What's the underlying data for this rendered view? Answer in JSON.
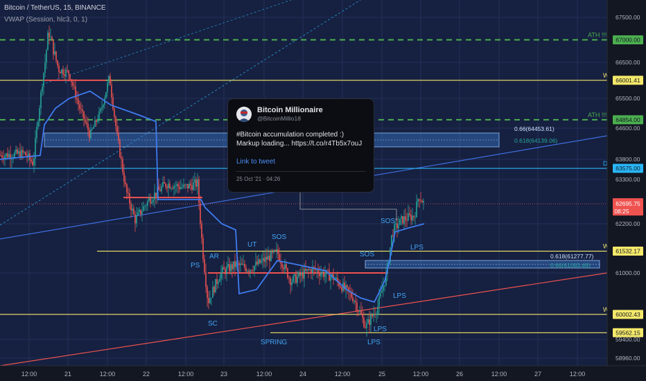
{
  "header": {
    "title": "Bitcoin / TetherUS, 15, BINANCE",
    "indicator": "VWAP (Session, hlc3, 0, 1)"
  },
  "colors": {
    "background": "#131722",
    "grid": "#1f2a4a",
    "vwap": "#2962ff",
    "green": "#26a69a",
    "red": "#ef5350",
    "yellow": "#f5e96a",
    "ath": "#4caf50",
    "cyan": "#29b6f6",
    "label_blue": "#42a5f5"
  },
  "tweet": {
    "name": "Bitcoin Millionaire",
    "handle": "@BitcoinMillio18",
    "text": "#Bitcoin accumulation completed :) Markup loading... https://t.co/r4Tb5x7ouJ",
    "link": "Link to tweet",
    "time": "25 Oct '21 · 04:26"
  },
  "chart_data": {
    "type": "candlestick",
    "symbol": "Bitcoin / TetherUS, 15, BINANCE",
    "x_ticks": [
      "12:00",
      "21",
      "12:00",
      "22",
      "12:00",
      "23",
      "12:00",
      "24",
      "12:00",
      "25",
      "12:00",
      "26",
      "12:00",
      "27",
      "12:00"
    ],
    "y_ticks": [
      67500,
      66500,
      65500,
      64600,
      63800,
      63300,
      62200,
      61000,
      59400,
      58960
    ],
    "ylim": [
      58800,
      67800
    ],
    "current_price": {
      "value": "62695.75",
      "countdown": "08:25"
    },
    "horizontal_levels": [
      {
        "price": 67000,
        "label": "67000.00",
        "note": "ATH !!!",
        "style": "dashed",
        "color": "#4caf50"
      },
      {
        "price": 66001.41,
        "label": "66001.41",
        "note": "W",
        "style": "solid",
        "color": "#f5e96a"
      },
      {
        "price": 64854,
        "label": "64854.00",
        "note": "ATH !!!",
        "style": "dashed",
        "color": "#4caf50"
      },
      {
        "price": 63575,
        "label": "63575.00",
        "note": "D",
        "style": "solid",
        "color": "#29b6f6"
      },
      {
        "price": 61532.17,
        "label": "61532.17",
        "note": "W",
        "style": "solid",
        "color": "#f5e96a"
      },
      {
        "price": 60002.43,
        "label": "60002.43",
        "note": "W",
        "style": "solid",
        "color": "#f5e96a"
      },
      {
        "price": 59562.15,
        "label": "59562.15",
        "note": "",
        "style": "solid",
        "color": "#f5e96a"
      }
    ],
    "fib_zones": [
      {
        "top_label": "0.66(64453.61)",
        "bottom_label": "0.618(64139.06)"
      },
      {
        "top_label": "0.618(61277.77)",
        "bottom_label": "0.66(61083.48)"
      }
    ],
    "wyckoff_labels": [
      "PS",
      "AR",
      "SC",
      "UT",
      "SOS",
      "SPRING",
      "SOS",
      "LPS",
      "LPS",
      "SOS",
      "LPS",
      "LPS"
    ]
  }
}
